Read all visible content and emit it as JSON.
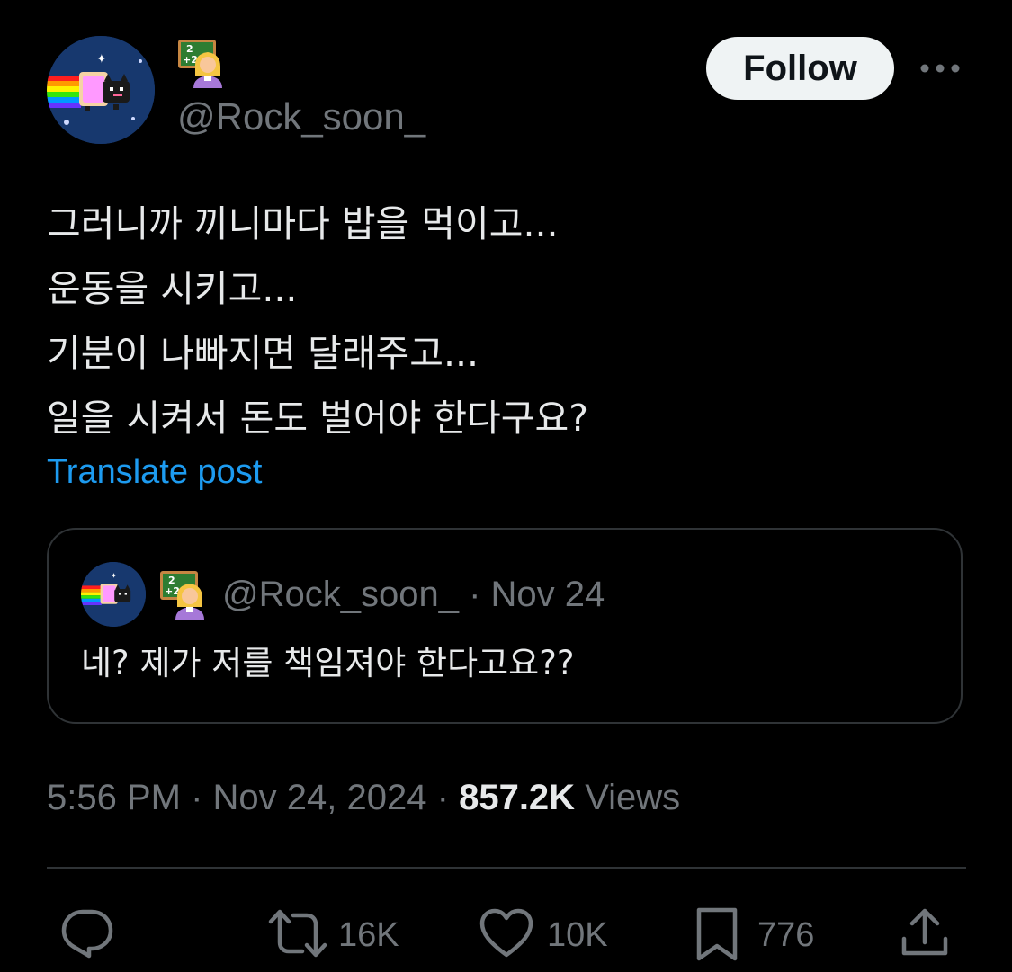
{
  "author": {
    "handle": "@Rock_soon_",
    "avatar_icon": "nyan-cat-avatar-icon",
    "name_icon": "teacher-emoji-icon"
  },
  "follow_label": "Follow",
  "more_icon": "more-dots-icon",
  "post": {
    "lines": [
      "그러니까 끼니마다 밥을 먹이고...",
      "운동을 시키고...",
      "기분이 나빠지면 달래주고...",
      "일을 시켜서 돈도 벌어야 한다구요?"
    ],
    "translate_label": "Translate post"
  },
  "quote": {
    "handle": "@Rock_soon_",
    "separator": "·",
    "date": "Nov 24",
    "text": "네? 제가 저를 책임져야 한다고요??"
  },
  "meta": {
    "time": "5:56 PM",
    "sep1": "·",
    "date": "Nov 24, 2024",
    "sep2": "·",
    "views_count": "857.2K",
    "views_label": "Views"
  },
  "actions": {
    "reply_icon": "reply-icon",
    "repost_icon": "repost-icon",
    "repost_count": "16K",
    "like_icon": "heart-icon",
    "like_count": "10K",
    "bookmark_icon": "bookmark-icon",
    "bookmark_count": "776",
    "share_icon": "share-icon"
  },
  "colors": {
    "background": "#000000",
    "text": "#e7e9ea",
    "secondary": "#71767b",
    "link": "#1d9bf0",
    "border": "#2f3336"
  }
}
